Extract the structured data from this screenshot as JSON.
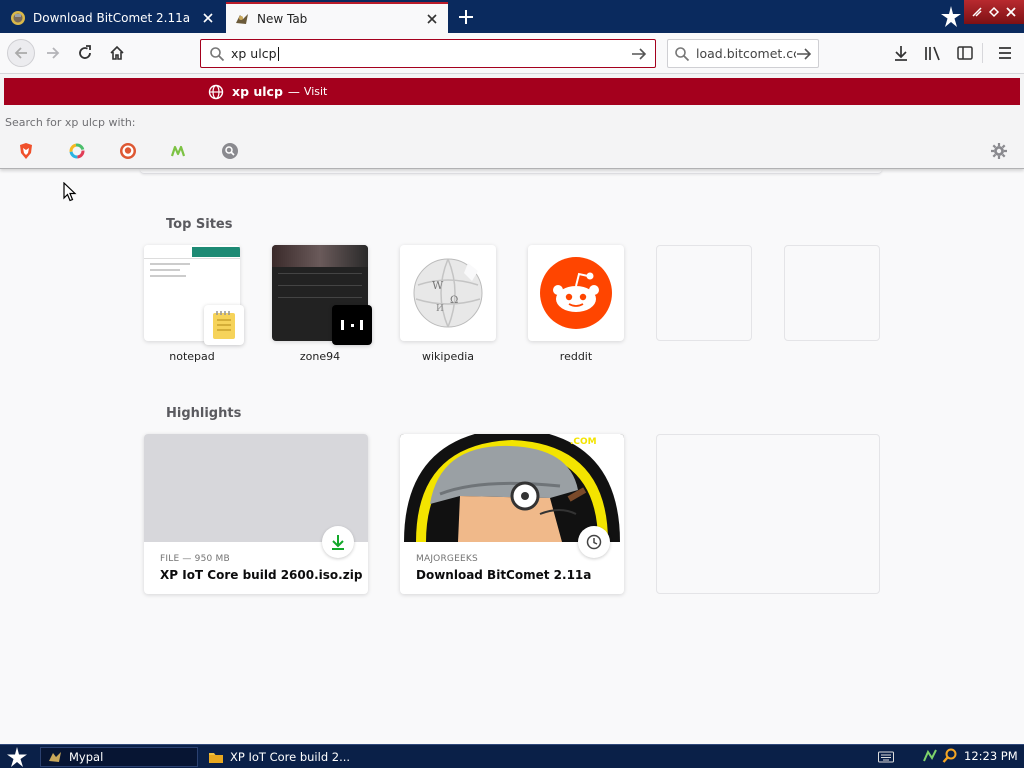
{
  "tabs": [
    {
      "title": "Download BitComet 2.11a",
      "favicon": "majorgeeks-favicon",
      "active": false
    },
    {
      "title": "New Tab",
      "favicon": "mypal-favicon",
      "active": true
    }
  ],
  "navbar": {
    "url_text": "xp ulcp",
    "search_text": "load.bitcomet.cc"
  },
  "url_popup": {
    "result_query": "xp ulcp",
    "result_dash": "—",
    "result_action": "Visit",
    "search_with_label": "Search for xp ulcp with:",
    "engines": [
      "brave-icon",
      "qwant-icon",
      "duckduckgo-icon",
      "mojeek-icon",
      "generic-search-icon"
    ]
  },
  "newtab": {
    "top_sites_title": "Top Sites",
    "top_sites": [
      {
        "label": "notepad"
      },
      {
        "label": "zone94"
      },
      {
        "label": "wikipedia"
      },
      {
        "label": "reddit"
      }
    ],
    "highlights_title": "Highlights",
    "highlights": [
      {
        "context": "FILE — 950 MB",
        "title": "XP IoT Core build 2600.iso.zip",
        "icon": "download-icon"
      },
      {
        "context": "MAJORGEEKS",
        "title": "Download BitComet 2.11a",
        "icon": "history-clock-icon"
      }
    ]
  },
  "taskbar": {
    "tasks": [
      {
        "label": "Mypal",
        "icon": "mypal-icon"
      },
      {
        "label": "XP IoT Core build 2...",
        "icon": "folder-icon"
      }
    ],
    "clock": "12:23 PM"
  },
  "colors": {
    "accent_red": "#a4001d",
    "tab_strip": "#0a2a5e",
    "taskbar": "#0a2048",
    "page_bg": "#f9f9fa"
  }
}
